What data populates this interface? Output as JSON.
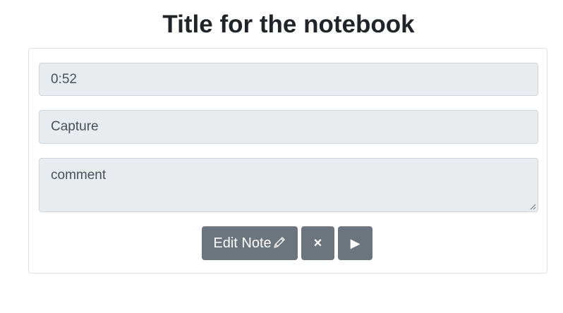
{
  "header": {
    "title": "Title for the notebook"
  },
  "note": {
    "time_value": "0:52",
    "capture_value": "Capture",
    "comment_value": "comment"
  },
  "buttons": {
    "edit_label": "Edit Note",
    "edit_icon": "pencil-icon",
    "close_label": "×",
    "play_label": "▶"
  },
  "colors": {
    "button_bg": "#6c757d",
    "field_bg": "#e9ecef",
    "title_text": "#212529"
  }
}
